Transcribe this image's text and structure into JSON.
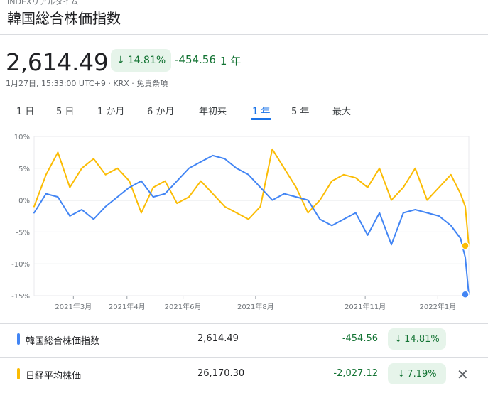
{
  "breadcrumb": "INDEXリアルタイム",
  "title": "韓国総合株価指数",
  "quote": {
    "price": "2,614.49",
    "percent_change": "14.81%",
    "arrow": "↓",
    "abs_change": "-454.56",
    "period": "1 年",
    "timestamp": "1月27日, 15:33:00 UTC+9 · KRX · ",
    "disclaimer": "免責条項"
  },
  "ranges": [
    "1 日",
    "5 日",
    "1 か月",
    "6 か月",
    "年初来",
    "1 年",
    "5 年",
    "最大"
  ],
  "active_range": "1 年",
  "colors": {
    "kospi": "#4285f4",
    "nikkei": "#fbbc04",
    "positive": "#137333",
    "badge_bg": "#e6f4ea",
    "zero_line": "#9aa0a6",
    "grid": "#e8eaed"
  },
  "chart_data": {
    "type": "line",
    "ylim": [
      -15,
      10
    ],
    "y_ticks": [
      "10%",
      "5%",
      "0%",
      "-5%",
      "-10%",
      "-15%"
    ],
    "y_tick_values": [
      10,
      5,
      0,
      -5,
      -10,
      -15
    ],
    "x_ticks": [
      "2021年3月",
      "2021年4月",
      "2021年6月",
      "2021年8月",
      "2021年11月",
      "2022年1月"
    ],
    "x_tick_dates": [
      "2021-03-01",
      "2021-04-15",
      "2021-06-01",
      "2021-08-01",
      "2021-11-01",
      "2022-01-01"
    ],
    "x_range": [
      "2021-01-27",
      "2022-01-27"
    ],
    "x": [
      "2021-01-27",
      "2021-02-06",
      "2021-02-16",
      "2021-02-26",
      "2021-03-08",
      "2021-03-18",
      "2021-03-28",
      "2021-04-07",
      "2021-04-17",
      "2021-04-27",
      "2021-05-07",
      "2021-05-17",
      "2021-05-27",
      "2021-06-06",
      "2021-06-16",
      "2021-06-26",
      "2021-07-06",
      "2021-07-16",
      "2021-07-26",
      "2021-08-05",
      "2021-08-15",
      "2021-08-25",
      "2021-09-04",
      "2021-09-14",
      "2021-09-24",
      "2021-10-04",
      "2021-10-14",
      "2021-10-24",
      "2021-11-03",
      "2021-11-13",
      "2021-11-23",
      "2021-12-03",
      "2021-12-13",
      "2021-12-23",
      "2022-01-02",
      "2022-01-12",
      "2022-01-20",
      "2022-01-24",
      "2022-01-27"
    ],
    "series": [
      {
        "name": "韓国総合株価指数",
        "values": [
          -2.0,
          1.0,
          0.5,
          -2.5,
          -1.5,
          -3.0,
          -1.0,
          0.5,
          2.0,
          3.0,
          0.5,
          1.0,
          3.0,
          5.0,
          6.0,
          7.0,
          6.5,
          5.0,
          4.0,
          2.0,
          0.0,
          1.0,
          0.5,
          0.0,
          -3.0,
          -4.0,
          -3.0,
          -2.0,
          -5.5,
          -2.0,
          -7.0,
          -2.0,
          -1.5,
          -2.0,
          -2.5,
          -4.0,
          -6.0,
          -9.0,
          -14.81
        ]
      },
      {
        "name": "日経平均株価",
        "values": [
          -1.0,
          4.0,
          7.5,
          2.0,
          5.0,
          6.5,
          4.0,
          5.0,
          3.0,
          -2.0,
          2.0,
          3.0,
          -0.5,
          0.5,
          3.0,
          1.0,
          -1.0,
          -2.0,
          -3.0,
          -1.0,
          8.0,
          5.0,
          2.0,
          -2.0,
          0.0,
          3.0,
          4.0,
          3.5,
          2.0,
          5.0,
          0.0,
          2.0,
          5.0,
          0.0,
          2.0,
          4.0,
          1.0,
          -1.0,
          -7.19
        ]
      }
    ]
  },
  "legend_rows": [
    {
      "name": "韓国総合株価指数",
      "value": "2,614.49",
      "change": "-454.56",
      "arrow": "↓",
      "percent": "14.81%"
    },
    {
      "name": "日経平均株価",
      "value": "26,170.30",
      "change": "-2,027.12",
      "arrow": "↓",
      "percent": "7.19%"
    }
  ],
  "close_glyph": "✕"
}
